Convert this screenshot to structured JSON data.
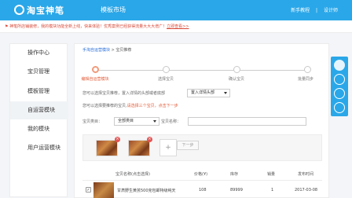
{
  "topbar": {
    "logo_text": "淘宝神笔",
    "app_title": "模板市场",
    "right_links": [
      "新手教程",
      "设计师"
    ]
  },
  "notice": {
    "text": "神笔所店铺装修，我的模块功能全新上线，快来体验！优秀案例已经获得流量大大大增广！",
    "link": "立即查看>>"
  },
  "sidebar": {
    "items": [
      {
        "label": "操作中心",
        "icon": "home-icon"
      },
      {
        "label": "宝贝管理"
      },
      {
        "label": "模板管理"
      },
      {
        "label": "自运营模块"
      },
      {
        "label": "我的模块"
      },
      {
        "label": "用户运营模块"
      }
    ]
  },
  "breadcrumb": {
    "link": "手淘自运营模块",
    "sep": ">",
    "current": "宝贝推荐"
  },
  "steps": [
    {
      "label": "编辑自运营模块",
      "active": true
    },
    {
      "label": "选择宝贝",
      "active": false
    },
    {
      "label": "确认宝贝",
      "active": false
    },
    {
      "label": "批量同步",
      "active": false
    }
  ],
  "form": {
    "line1": "您可以选择宝贝推荐，置入详情的头部或者底部",
    "position_select": "置入详情头部",
    "line2_prefix": "您可以选择要推荐的宝贝,",
    "line2_orange": "请选择三个宝贝，点击下一步",
    "category_label": "宝贝类目：",
    "category_value": "全部类目",
    "name_label": "宝贝名称："
  },
  "picker": {
    "remove_symbol": "×",
    "plus_symbol": "+",
    "next_label": "下一步"
  },
  "table": {
    "headers": [
      "宝贝名称(点击选择)",
      "价格(¥)",
      "库存",
      "销量",
      "发布时间"
    ],
    "rows": [
      {
        "checked": "✓",
        "name": "甘肃野生黄芪500克包邮特级纯天",
        "price": "108",
        "stock": "89999",
        "sales": "1",
        "date": "2017-03-08"
      }
    ]
  },
  "float_toolbar": {
    "icons": [
      "cloud-icon",
      "drop-icon",
      "clipboard-icon",
      "clock-icon"
    ]
  }
}
